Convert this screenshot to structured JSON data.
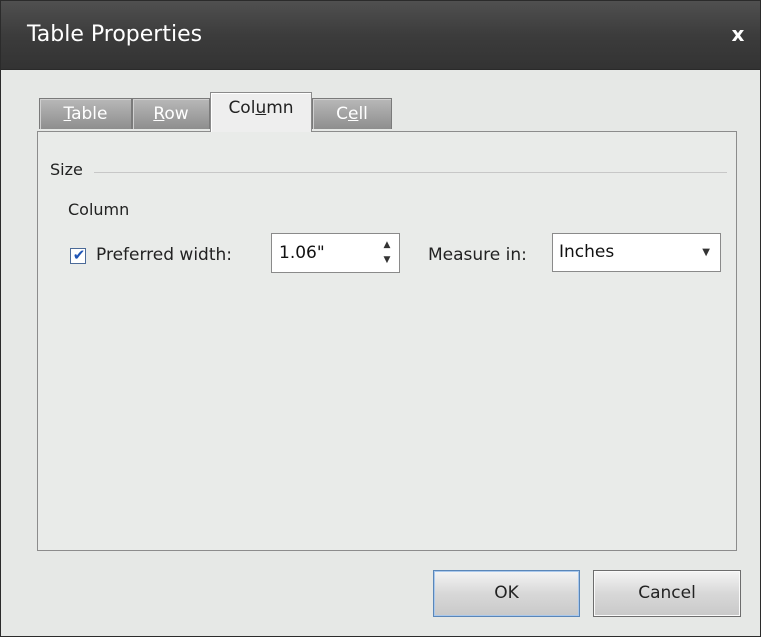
{
  "window": {
    "title": "Table Properties",
    "close_glyph": "x"
  },
  "tabs": [
    {
      "label_pre": "",
      "label_key": "T",
      "label_post": "able",
      "active": false
    },
    {
      "label_pre": "",
      "label_key": "R",
      "label_post": "ow",
      "active": false
    },
    {
      "label_pre": "Col",
      "label_key": "u",
      "label_post": "mn",
      "active": true
    },
    {
      "label_pre": "C",
      "label_key": "e",
      "label_post": "ll",
      "active": false
    }
  ],
  "column_tab": {
    "group_title": "Size",
    "subgroup_title": "Column",
    "preferred_width": {
      "checked": true,
      "label": "Preferred width:",
      "value": "1.06\""
    },
    "measure_in": {
      "label": "Measure in:",
      "selected": "Inches"
    }
  },
  "buttons": {
    "ok": "OK",
    "cancel": "Cancel"
  },
  "icons": {
    "checkmark": "check-icon",
    "spin_up": "spin-up-arrow-icon",
    "spin_down": "spin-down-arrow-icon",
    "dropdown": "chevron-down-icon",
    "close": "close-icon"
  },
  "colors": {
    "titlebar": "#3c3c3c",
    "dialog_bg": "#e6e8e6",
    "ok_border": "#5a86b8",
    "check": "#1f55b5"
  }
}
